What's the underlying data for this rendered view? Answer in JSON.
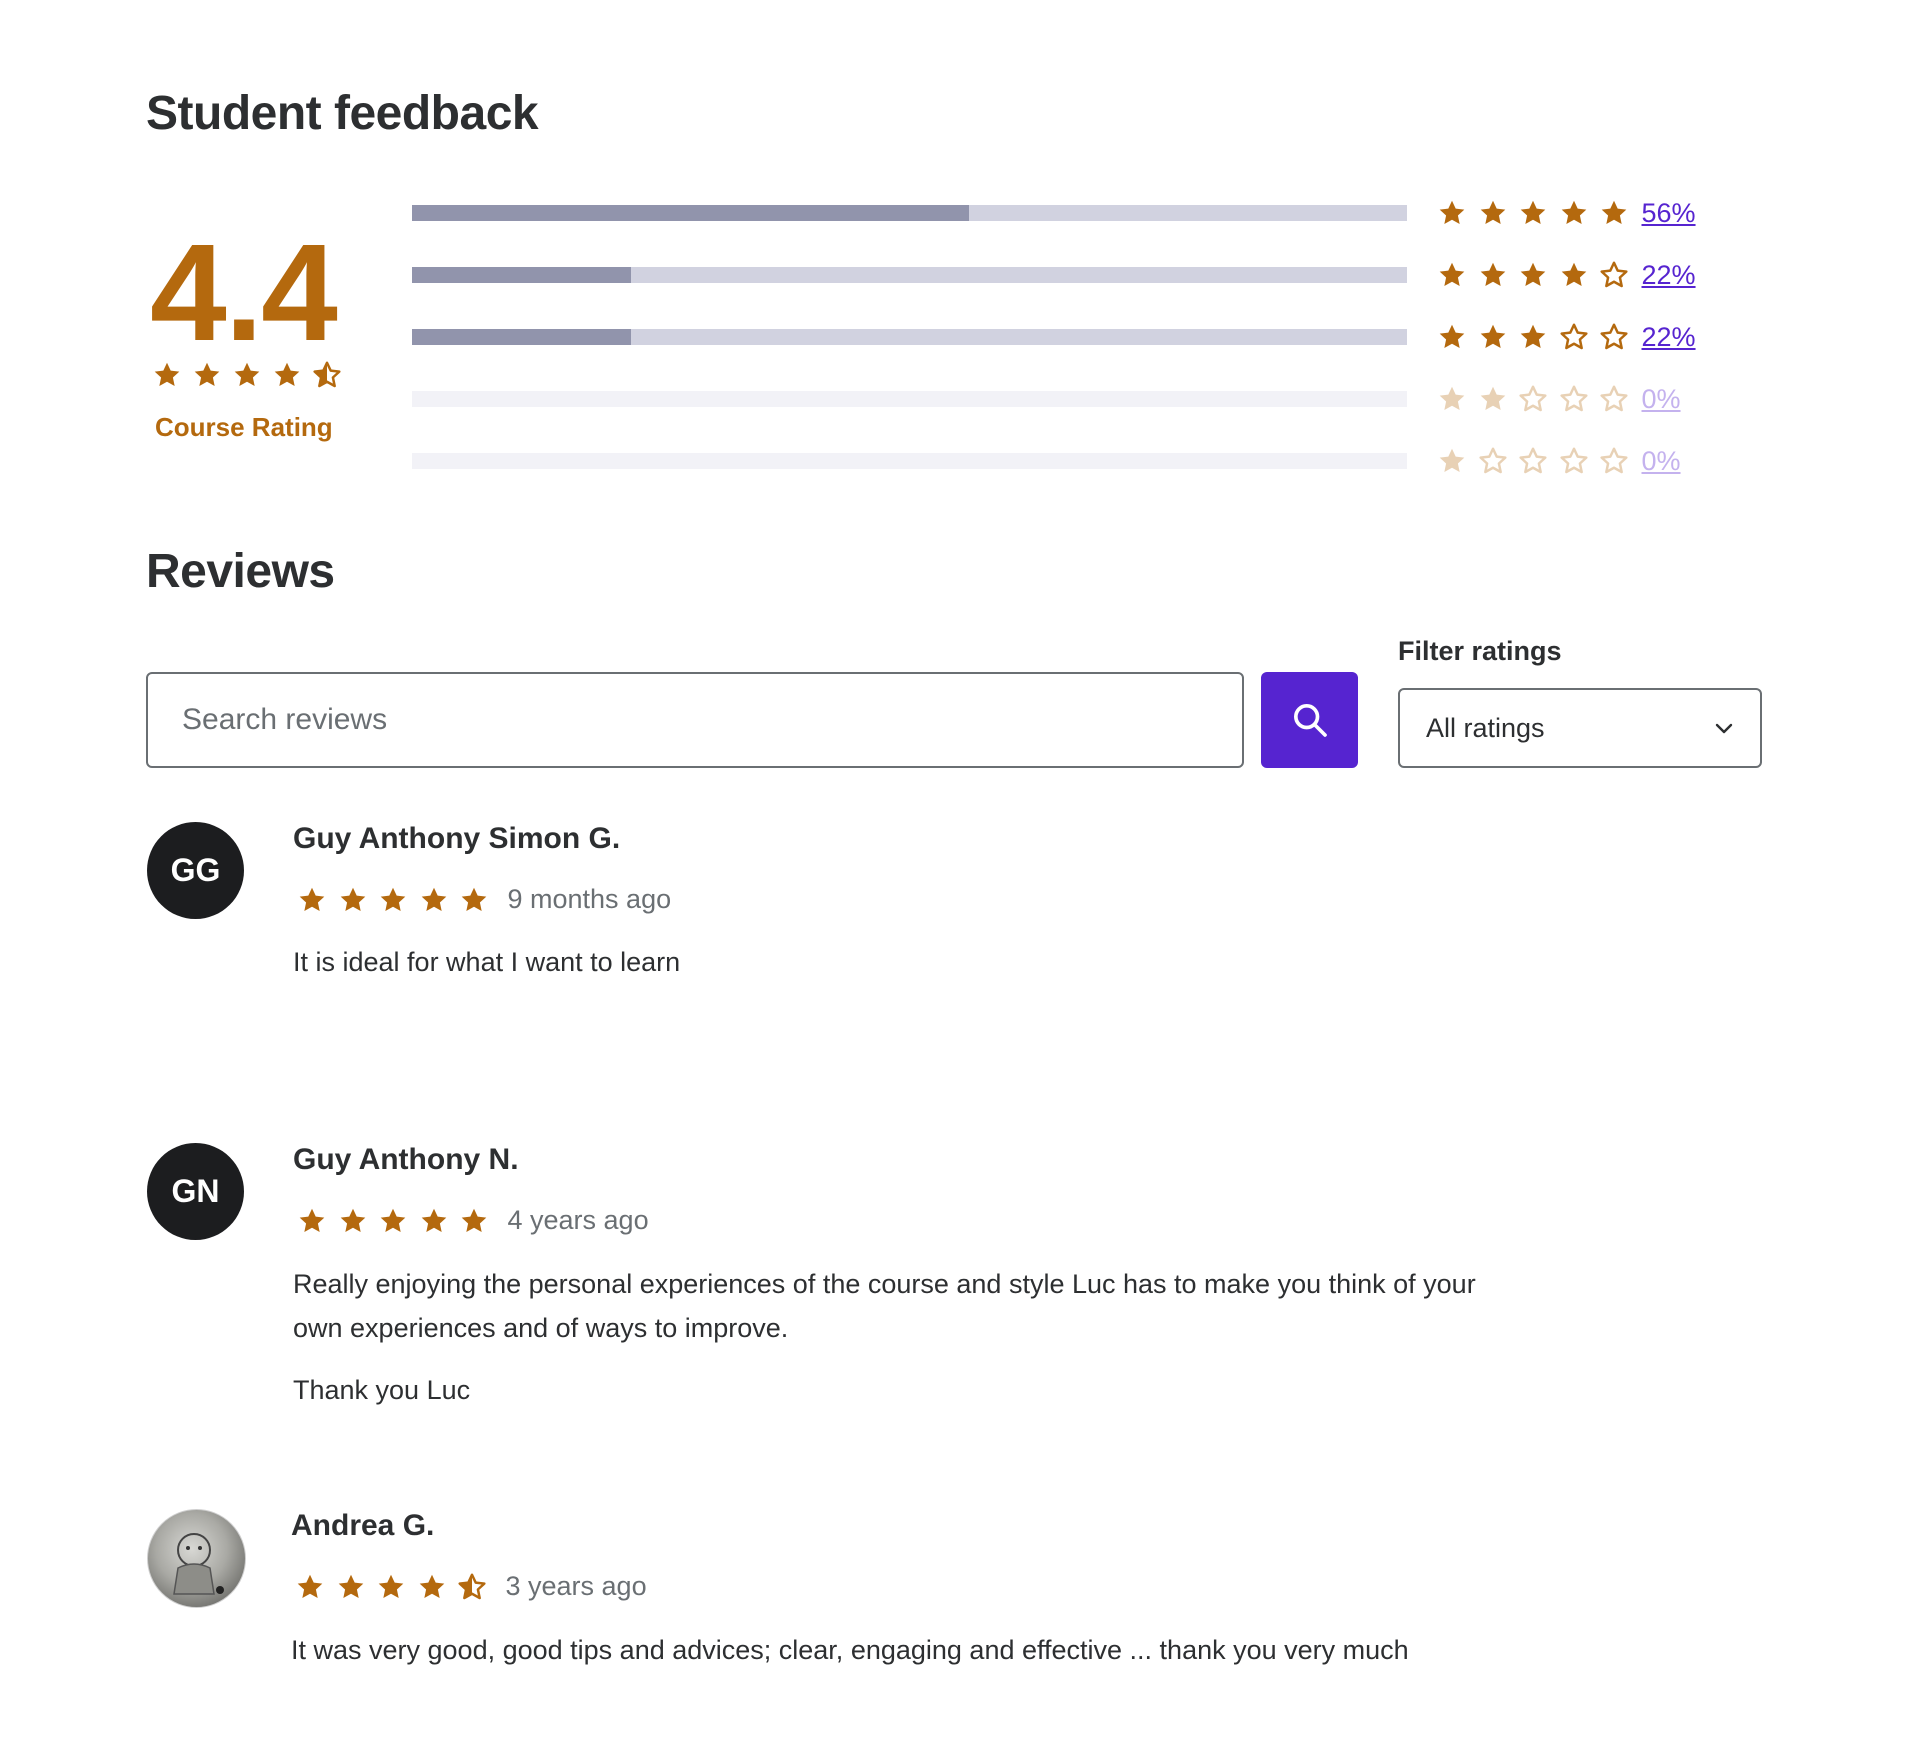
{
  "feedback": {
    "title": "Student feedback",
    "average": "4.4",
    "average_stars": 4.5,
    "label": "Course Rating",
    "breakdown": [
      {
        "stars": 5,
        "fill": 0.56,
        "percent": "56%",
        "faded": false
      },
      {
        "stars": 4,
        "fill": 0.22,
        "percent": "22%",
        "faded": false
      },
      {
        "stars": 3,
        "fill": 0.22,
        "percent": "22%",
        "faded": false
      },
      {
        "stars": 2,
        "fill": 0.0,
        "percent": "0%",
        "faded": true
      },
      {
        "stars": 1,
        "fill": 0.0,
        "percent": "0%",
        "faded": true
      }
    ]
  },
  "reviews_section": {
    "title": "Reviews",
    "search": {
      "placeholder": "Search reviews"
    },
    "filter": {
      "label": "Filter ratings",
      "selected": "All ratings"
    }
  },
  "reviews": [
    {
      "initials": "GG",
      "name": "Guy Anthony Simon G.",
      "stars": 5,
      "date": "9 months ago",
      "paragraphs": [
        "It is ideal for what I want to learn"
      ]
    },
    {
      "initials": "GN",
      "name": "Guy Anthony N.",
      "stars": 5,
      "date": "4 years ago",
      "paragraphs": [
        "Really enjoying the personal experiences of the course and style Luc has to make you think of your",
        "own experiences and of ways to improve.",
        "Thank you Luc"
      ]
    },
    {
      "initials": "",
      "name": "Andrea G.",
      "stars": 4.5,
      "date": "3 years ago",
      "paragraphs": [
        "It was very good, good tips and advices; clear, engaging and effective ... thank you very much"
      ]
    }
  ],
  "colors": {
    "star": "#b4690e",
    "accent": "#5624d0",
    "bar_fill": "#9194ac",
    "bar_track": "#d1d2e0"
  },
  "icons": {
    "star_full": "star-icon",
    "star_half": "star-half-icon",
    "star_empty": "star-outline-icon",
    "search": "search-icon",
    "chevron": "chevron-down-icon"
  }
}
